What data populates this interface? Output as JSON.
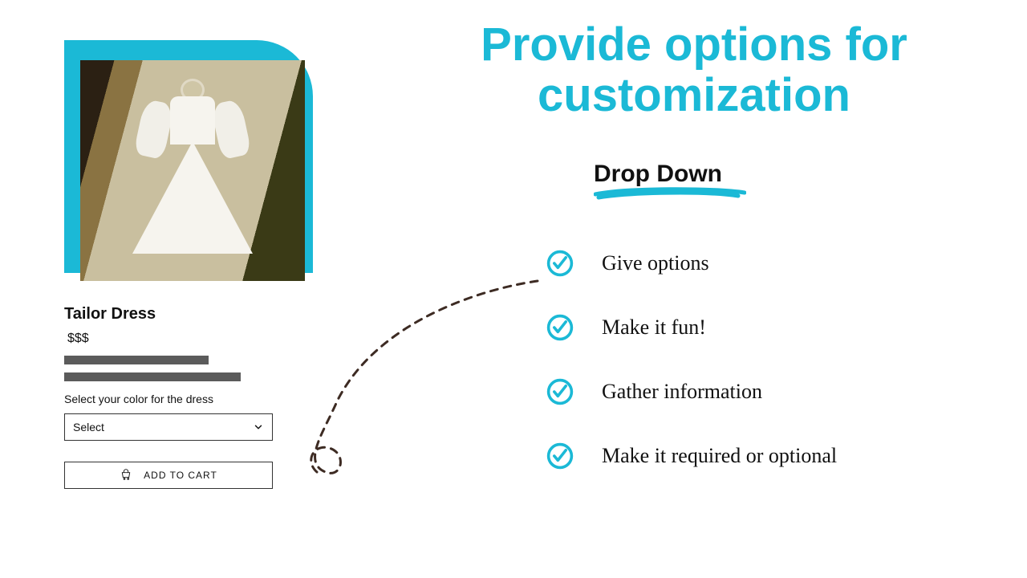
{
  "colors": {
    "accent": "#1bb9d6",
    "text": "#111111",
    "bar": "#5b5b5b",
    "dash": "#3d2b23"
  },
  "headline": "Provide options for customization",
  "subhead": "Drop Down",
  "bullets": [
    "Give options",
    "Make it fun!",
    "Gather information",
    "Make it required or optional"
  ],
  "product": {
    "image_alt": "white dress on mannequin",
    "title": "Tailor Dress",
    "price": "$$$",
    "option_label": "Select your color for the dress",
    "select_placeholder": "Select",
    "cta": "ADD TO CART"
  },
  "icons": {
    "chevron": "chevron-down-icon",
    "cart": "cart-icon",
    "check": "check-circle-icon"
  }
}
